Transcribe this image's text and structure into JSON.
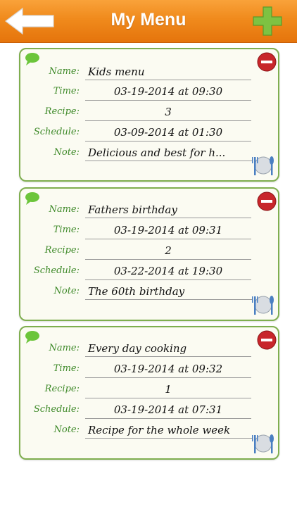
{
  "nav": {
    "title": "My Menu",
    "back_icon": "back-arrow-icon",
    "add_icon": "plus-icon",
    "accent_color": "#f08a1c",
    "add_color": "#7ec242"
  },
  "labels": {
    "name": "Name:",
    "time": "Time:",
    "recipe": "Recipe:",
    "schedule": "Schedule:",
    "note": "Note:"
  },
  "menus": [
    {
      "name": "Kids menu",
      "time": "03-19-2014 at 09:30",
      "recipe": "3",
      "schedule": "03-09-2014 at 01:30",
      "note": "Delicious and best for h..."
    },
    {
      "name": "Fathers birthday",
      "time": "03-19-2014 at 09:31",
      "recipe": "2",
      "schedule": "03-22-2014 at 19:30",
      "note": "The 60th birthday"
    },
    {
      "name": "Every day cooking",
      "time": "03-19-2014 at 09:32",
      "recipe": "1",
      "schedule": "03-19-2014 at 07:31",
      "note": "Recipe for the whole week"
    }
  ]
}
